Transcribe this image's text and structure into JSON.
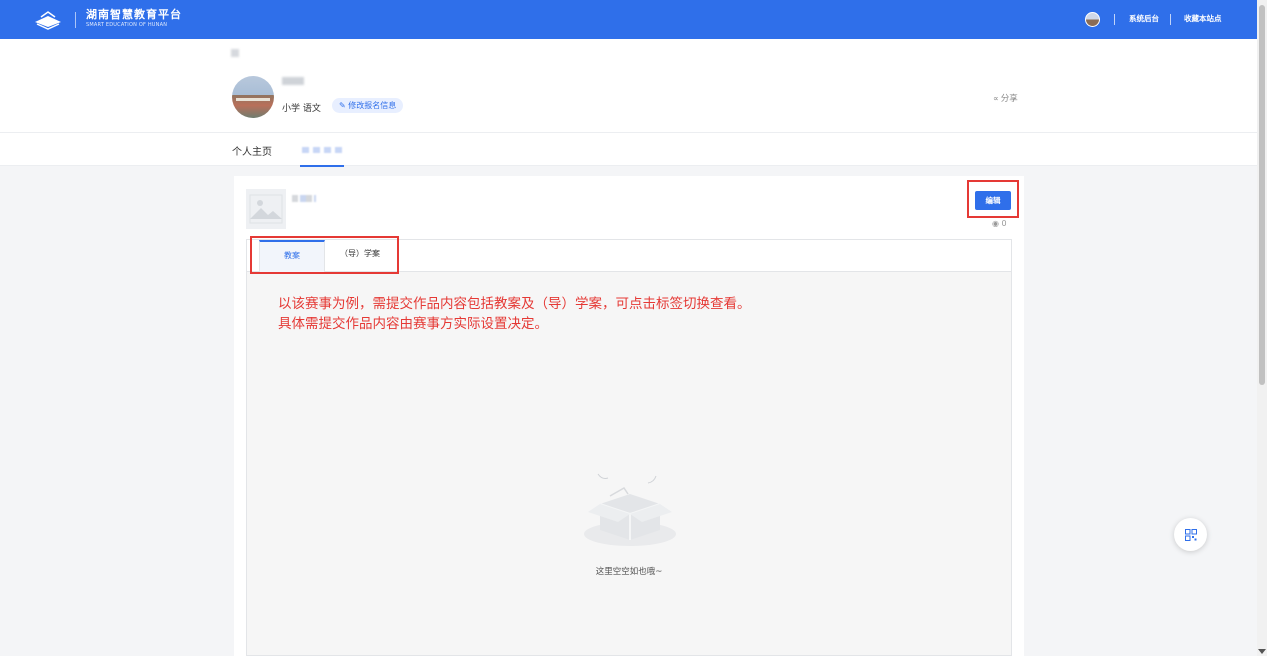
{
  "header": {
    "logo_cn": "湖南智慧教育平台",
    "logo_en": "SMART EDUCATION OF HUNAN",
    "links": [
      "系统后台",
      "收藏本站点"
    ]
  },
  "profile": {
    "subject": "小学 语文",
    "edit_tag": "修改报名信息",
    "share": "分享"
  },
  "nav": {
    "home": "个人主页"
  },
  "work": {
    "edit_button": "编辑",
    "view_count": "0",
    "tabs": [
      "教案",
      "（导）学案"
    ],
    "annotation": [
      "以该赛事为例，需提交作品内容包括教案及（导）学案，可点击标签切换查看。",
      "具体需提交作品内容由赛事方实际设置决定。"
    ],
    "empty_text": "这里空空如也哦~"
  },
  "colors": {
    "primary": "#2f6fea",
    "annotation": "#e53935"
  }
}
